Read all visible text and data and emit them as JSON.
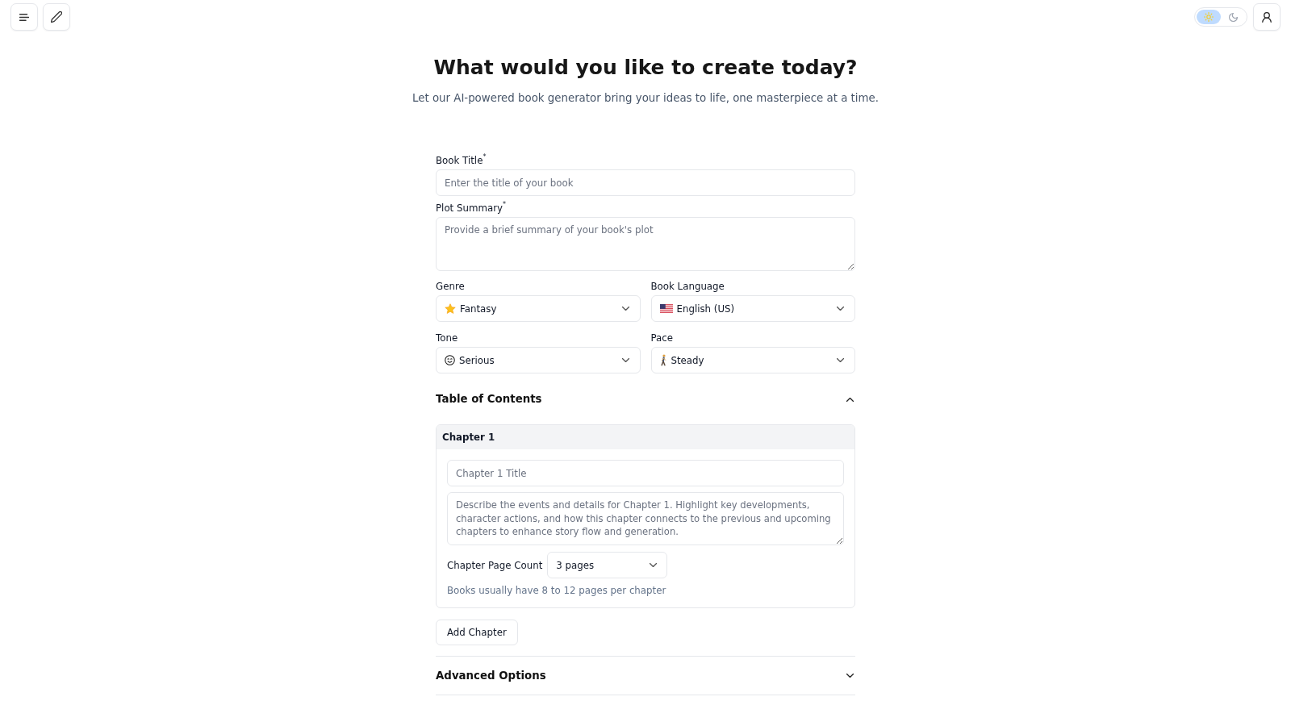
{
  "theme_toggle": [
    {
      "kind": "light",
      "selected": true
    },
    {
      "kind": "dark",
      "selected": false
    }
  ],
  "page": {
    "title": "What would you like to create today?",
    "subtitle": "Let our AI-powered book generator bring your ideas to life, one masterpiece at a time."
  },
  "form": {
    "book_title": {
      "label": "Book Title$^{*}$",
      "placeholder": "Enter the title of your book"
    },
    "plot_summary": {
      "label": "Plot Summary$^{*}$",
      "placeholder": "Provide a brief summary of your book's plot"
    },
    "selects": [
      {
        "label": "Genre",
        "value": "Fantasy"
      },
      {
        "label": "Book Language",
        "value": "English (US)"
      },
      {
        "label": "Tone",
        "value": "Serious"
      },
      {
        "label": "Pace",
        "value": "Steady"
      }
    ]
  },
  "table_of_contents": {
    "title": "Table of Contents",
    "expanded": true,
    "chapters": [
      {
        "header": "Chapter 1",
        "title_placeholder": "Chapter 1 Title",
        "description_placeholder": "Describe the events and details for Chapter 1. Highlight key developments, character actions, and how this chapter connects to the previous and upcoming chapters to enhance story flow and generation.",
        "page_count_label": "Chapter Page Count",
        "page_count": "3 pages",
        "hint": "Books usually have 8 to 12 pages per chapter"
      }
    ],
    "add_button": "Add Chapter"
  },
  "advanced_options": {
    "title": "Advanced Options",
    "expanded": false
  }
}
